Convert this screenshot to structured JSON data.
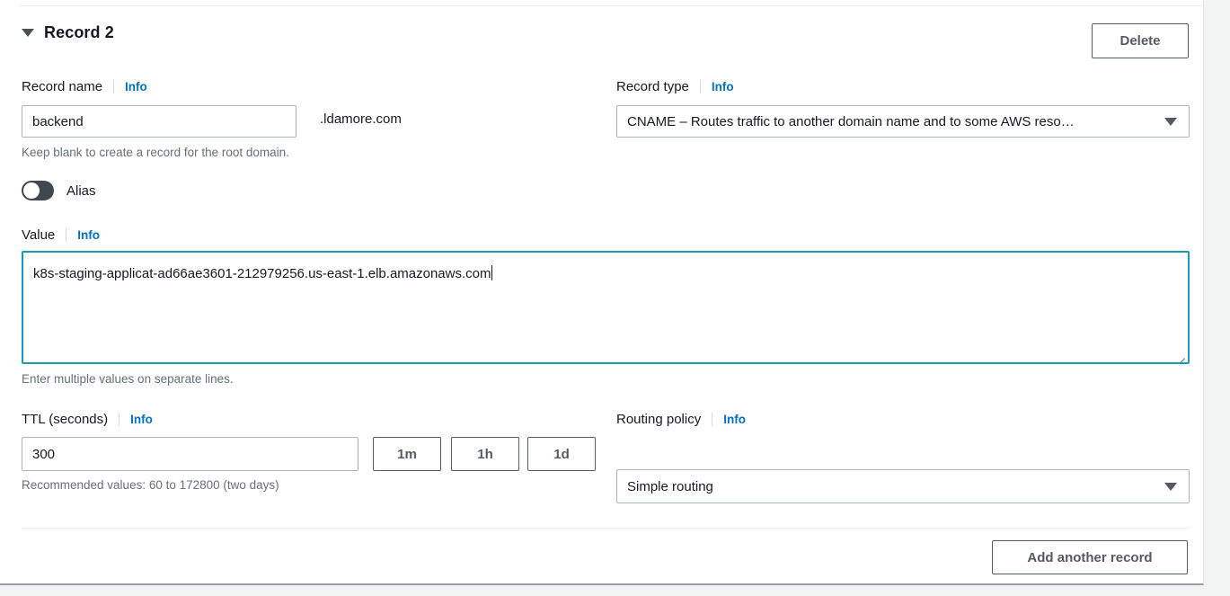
{
  "record": {
    "title": "Record 2",
    "collapse_icon": "triangle-down-icon",
    "delete_label": "Delete",
    "add_another_label": "Add another record",
    "info_label": "Info"
  },
  "record_name": {
    "label": "Record name",
    "info": "Info",
    "value": "backend",
    "placeholder": "",
    "suffix": ".ldamore.com",
    "helper": "Keep blank to create a record for the root domain."
  },
  "record_type": {
    "label": "Record type",
    "info": "Info",
    "selected": "CNAME – Routes traffic to another domain name and to some AWS reso…",
    "caret_icon": "chevron-down-icon"
  },
  "alias": {
    "label": "Alias",
    "enabled": false
  },
  "value": {
    "label": "Value",
    "info": "Info",
    "text": "k8s-staging-applicat-ad66ae3601-212979256.us-east-1.elb.amazonaws.com",
    "helper": "Enter multiple values on separate lines.",
    "focused": true,
    "resize_icon": "resize-grip-icon"
  },
  "ttl": {
    "label": "TTL (seconds)",
    "info": "Info",
    "value": "300",
    "helper": "Recommended values: 60 to 172800 (two days)",
    "quick_buttons": [
      "1m",
      "1h",
      "1d"
    ]
  },
  "routing_policy": {
    "label": "Routing policy",
    "info": "Info",
    "selected": "Simple routing",
    "caret_icon": "chevron-down-icon"
  },
  "colors": {
    "link": "#0073bb",
    "focus_border": "#1a9cb0",
    "text": "#16191f",
    "helper_text": "#687078",
    "button_border": "#545b64"
  }
}
